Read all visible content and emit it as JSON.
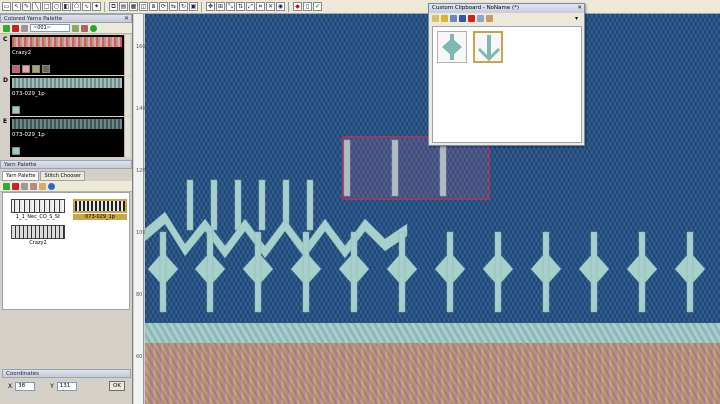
{
  "panels": {
    "colored_yarns": {
      "title": "Colored Yarns Palette",
      "dropdown_value": "~001~",
      "entries": [
        {
          "letter": "C",
          "name": "Crazy2",
          "strip_color": "#7a6f6a",
          "chips": [
            "#d9576a",
            "#e7a3b0",
            "#a7a46a",
            "#6a6a4a"
          ]
        },
        {
          "letter": "D",
          "name": "073-029_1p",
          "strip_color": "#9fbcb8",
          "chips": [
            "#9fc7c3"
          ]
        },
        {
          "letter": "E",
          "name": "073-029_1p",
          "strip_color": "#6a8a88",
          "chips": [
            "#9fc7c3"
          ]
        }
      ]
    },
    "yarn_palette": {
      "title": "Yarn Palette",
      "tabs": [
        "Yarn Palette",
        "Stitch Chooser"
      ],
      "yarns": [
        {
          "label": "1_1_Nec_CO_S_St",
          "selected": false
        },
        {
          "label": "073-029_1p",
          "selected": true
        },
        {
          "label": "Crazy2",
          "selected": false
        }
      ]
    },
    "coordinates": {
      "title": "Coordinates",
      "x_label": "X",
      "x_value": "38",
      "y_label": "Y",
      "y_value": "131",
      "ok_label": "OK"
    }
  },
  "ruler": {
    "ticks": [
      "160",
      "140",
      "120",
      "100",
      "80",
      "60"
    ]
  },
  "clipboard": {
    "title": "Custom Clipboard - NoName (*)",
    "items": [
      {
        "icon": "diamond-motif-icon",
        "selected": false
      },
      {
        "icon": "arrow-motif-icon",
        "selected": true
      }
    ]
  },
  "colors": {
    "background_knit": "#1f4f86",
    "motif": "#a7d0cc",
    "selection": "#e0203a",
    "accent": "#c9a64a"
  }
}
